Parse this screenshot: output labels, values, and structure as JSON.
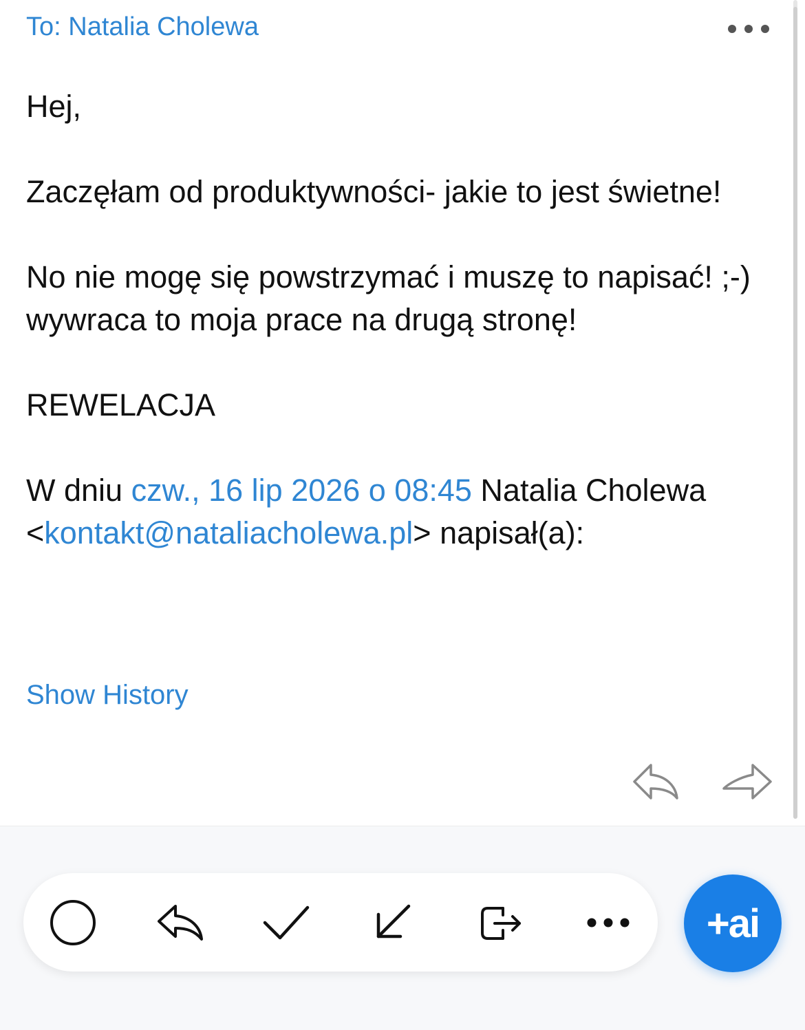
{
  "header": {
    "to_line": "To: Natalia Cholewa",
    "more_icon": "more-horizontal-icon"
  },
  "message": {
    "greeting": "Hej,",
    "para1": "Zaczęłam od produktywności- jakie to jest świetne!",
    "para2": "No nie mogę się powstrzymać i muszę to napisać! ;-) wywraca to moja prace na drugą stronę!",
    "para3": "REWELACJA",
    "quote_prefix": "W dniu ",
    "quote_date": "czw., 16 lip 2026 o 08:45",
    "quote_sender": " Natalia Cholewa <",
    "quote_email": "kontakt@nataliacholewa.pl",
    "quote_suffix": "> napisał(a):"
  },
  "show_history": "Show History",
  "toolbar": {
    "items": [
      {
        "name": "mark-unread",
        "icon": "circle-icon"
      },
      {
        "name": "reply",
        "icon": "reply-icon"
      },
      {
        "name": "done",
        "icon": "checkmark-icon"
      },
      {
        "name": "move-down",
        "icon": "arrow-down-left-icon"
      },
      {
        "name": "move-to",
        "icon": "move-out-icon"
      },
      {
        "name": "more",
        "icon": "more-horizontal-icon"
      }
    ],
    "ai_label": "+ai"
  },
  "colors": {
    "link_blue": "#2f86d3",
    "ai_blue": "#1a7fe6",
    "text": "#111111"
  }
}
